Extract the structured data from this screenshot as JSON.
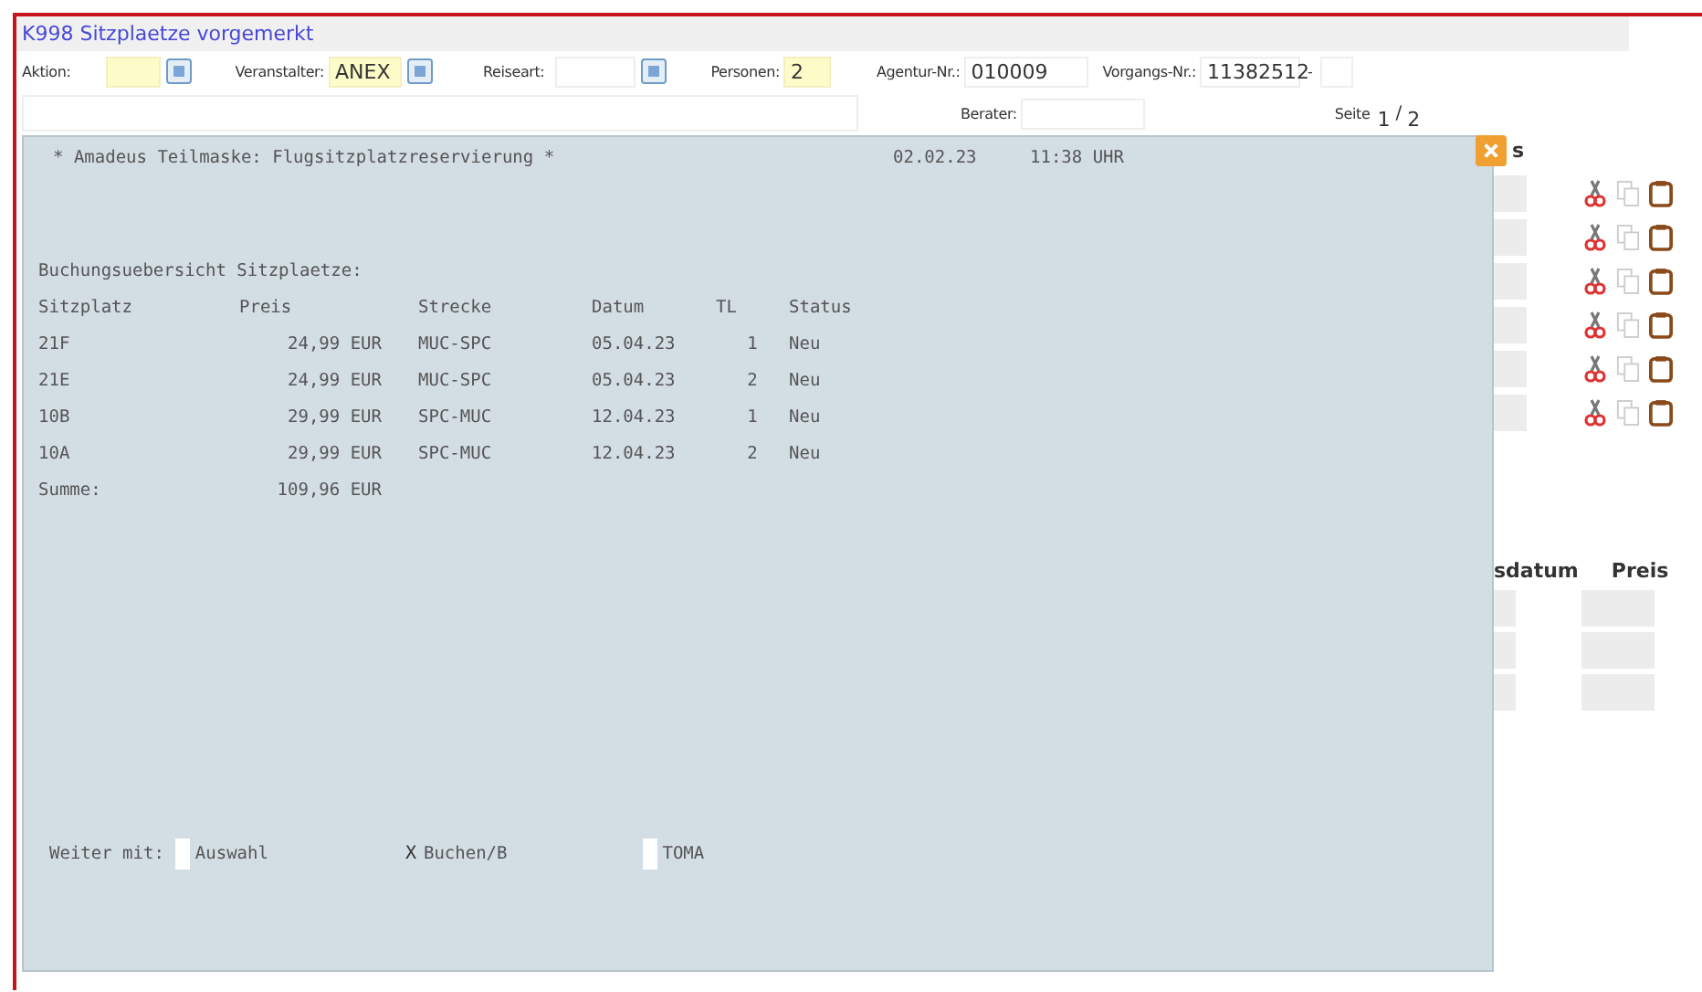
{
  "window": {
    "title": "K998 Sitzplaetze vorgemerkt"
  },
  "form": {
    "fields": [
      {
        "label": "Aktion:",
        "highlight": true,
        "lookup": true
      },
      {
        "label": "Veranstalter:",
        "value": "ANEX",
        "highlight": true,
        "lookup": true
      },
      {
        "label": "Reiseart:",
        "highlight": false,
        "lookup": true
      },
      {
        "label": "Personen:",
        "value": "2",
        "highlight": true,
        "lookup": false
      }
    ],
    "agentur": {
      "label": "Agentur-Nr.:",
      "value": "010009"
    },
    "vorgang": {
      "label": "Vorgangs-Nr.:",
      "value": "11382512",
      "separator": "-"
    },
    "berater": {
      "label": "Berater:"
    },
    "seite": {
      "label": "Seite",
      "current": "1",
      "separator": "/",
      "total": "2"
    }
  },
  "background": {
    "header_fragment": "s",
    "table_headers": [
      "sdatum",
      "Preis"
    ]
  },
  "dialog": {
    "title": "* Amadeus Teilmaske: Flugsitzplatzreservierung *",
    "date": "02.02.23",
    "time": "11:38 UHR",
    "subtitle": "Buchungsuebersicht Sitzplaetze:",
    "columns": [
      "Sitzplatz",
      "Preis",
      "Strecke",
      "Datum",
      "TL",
      "Status"
    ],
    "rows": [
      {
        "seat": "21F",
        "price": "24,99 EUR",
        "route": "MUC-SPC",
        "date": "05.04.23",
        "tl": "1",
        "status": "Neu"
      },
      {
        "seat": "21E",
        "price": "24,99 EUR",
        "route": "MUC-SPC",
        "date": "05.04.23",
        "tl": "2",
        "status": "Neu"
      },
      {
        "seat": "10B",
        "price": "29,99 EUR",
        "route": "SPC-MUC",
        "date": "12.04.23",
        "tl": "1",
        "status": "Neu"
      },
      {
        "seat": "10A",
        "price": "29,99 EUR",
        "route": "SPC-MUC",
        "date": "12.04.23",
        "tl": "2",
        "status": "Neu"
      }
    ],
    "sum": {
      "label": "Summe:",
      "value": "109,96 EUR"
    },
    "next": {
      "label": "Weiter mit:",
      "options": [
        {
          "label": "Auswahl",
          "selected": false
        },
        {
          "label": "Buchen/B",
          "selected": true,
          "value": "X"
        },
        {
          "label": "TOMA",
          "selected": false
        }
      ]
    }
  }
}
